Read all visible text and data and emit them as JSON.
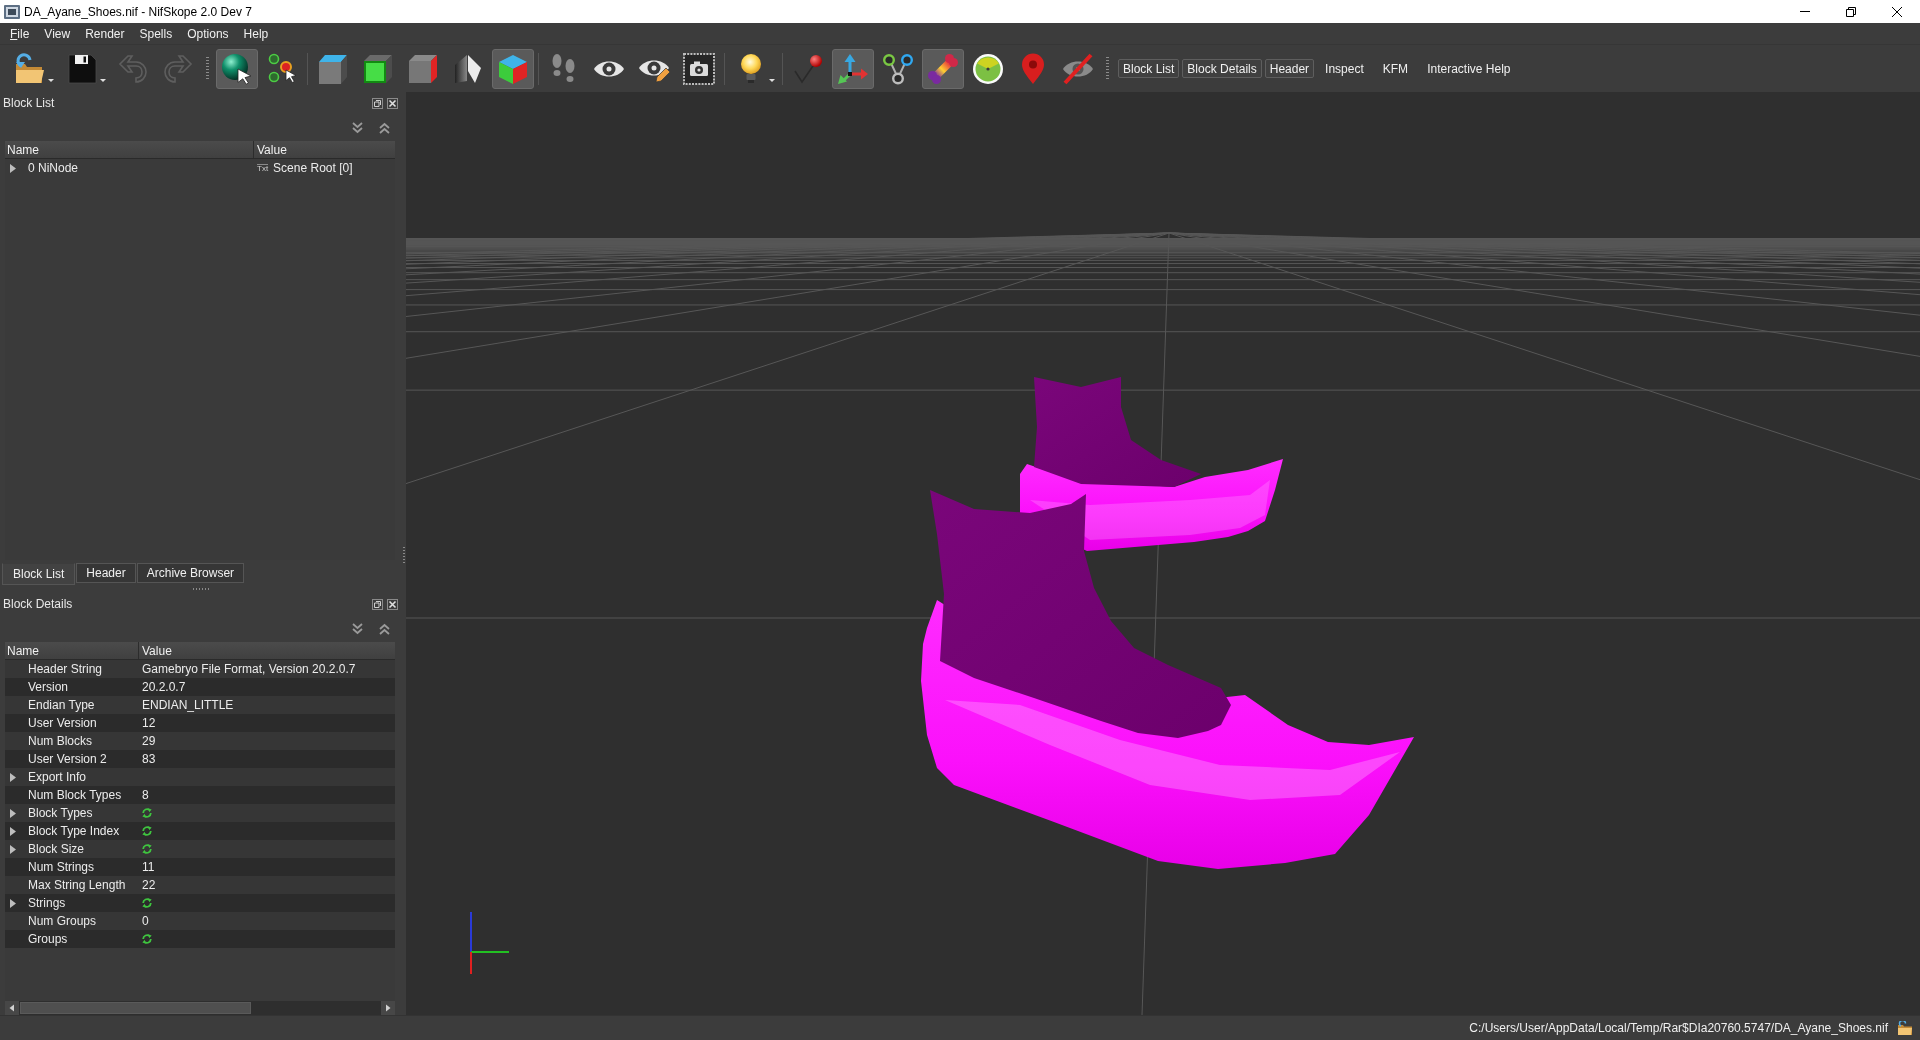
{
  "window": {
    "title": "DA_Ayane_Shoes.nif - NifSkope 2.0 Dev 7"
  },
  "menu": [
    {
      "label": "File",
      "mnemonic": true
    },
    {
      "label": "View",
      "mnemonic": false
    },
    {
      "label": "Render",
      "mnemonic": false
    },
    {
      "label": "Spells",
      "mnemonic": false
    },
    {
      "label": "Options",
      "mnemonic": false
    },
    {
      "label": "Help",
      "mnemonic": false
    }
  ],
  "toolbar": {
    "groups": [
      [
        {
          "pressed": false,
          "dropdown": true,
          "disabled": false
        },
        {
          "pressed": false,
          "dropdown": true,
          "disabled": false
        },
        {
          "pressed": false,
          "dropdown": false,
          "disabled": true
        },
        {
          "pressed": false,
          "dropdown": false,
          "disabled": true
        }
      ],
      [
        {
          "pressed": true,
          "dropdown": false,
          "disabled": false
        },
        {
          "pressed": false,
          "dropdown": false,
          "disabled": false
        }
      ],
      [
        {
          "pressed": false,
          "dropdown": false,
          "disabled": false
        },
        {
          "pressed": false,
          "dropdown": false,
          "disabled": false
        },
        {
          "pressed": false,
          "dropdown": false,
          "disabled": false
        },
        {
          "pressed": false,
          "dropdown": false,
          "disabled": false
        },
        {
          "pressed": true,
          "dropdown": false,
          "disabled": false
        }
      ],
      [
        {
          "pressed": false,
          "dropdown": false,
          "disabled": false
        },
        {
          "pressed": false,
          "dropdown": false,
          "disabled": false
        },
        {
          "pressed": false,
          "dropdown": false,
          "disabled": false
        },
        {
          "pressed": false,
          "dropdown": false,
          "disabled": false
        }
      ],
      [
        {
          "pressed": false,
          "dropdown": true,
          "disabled": false
        }
      ],
      [
        {
          "pressed": false,
          "dropdown": false,
          "disabled": false
        },
        {
          "pressed": true,
          "dropdown": false,
          "disabled": false
        },
        {
          "pressed": false,
          "dropdown": false,
          "disabled": false
        },
        {
          "pressed": true,
          "dropdown": false,
          "disabled": false
        },
        {
          "pressed": false,
          "dropdown": false,
          "disabled": false
        },
        {
          "pressed": false,
          "dropdown": false,
          "disabled": false
        },
        {
          "pressed": false,
          "dropdown": false,
          "disabled": false
        }
      ]
    ],
    "dock_buttons": [
      {
        "label": "Block List",
        "checked": true
      },
      {
        "label": "Block Details",
        "checked": true
      },
      {
        "label": "Header",
        "checked": true
      },
      {
        "label": "Inspect",
        "checked": false
      },
      {
        "label": "KFM",
        "checked": false
      },
      {
        "label": "Interactive Help",
        "checked": false
      }
    ]
  },
  "block_list": {
    "title": "Block List",
    "columns": [
      "Name",
      "Value"
    ],
    "rows": [
      {
        "name": "0 NiNode",
        "type_label": "Txt",
        "value": "Scene Root [0]",
        "expanded": false
      }
    ]
  },
  "dock_tabs": [
    {
      "label": "Block List",
      "selected": true
    },
    {
      "label": "Header",
      "selected": false
    },
    {
      "label": "Archive Browser",
      "selected": false
    }
  ],
  "block_details": {
    "title": "Block Details",
    "columns": [
      "Name",
      "Value"
    ],
    "rows": [
      {
        "name": "Header String",
        "kind": "value",
        "value": "Gamebryo File Format, Version 20.2.0.7"
      },
      {
        "name": "Version",
        "kind": "value",
        "value": "20.2.0.7"
      },
      {
        "name": "Endian Type",
        "kind": "value",
        "value": "ENDIAN_LITTLE"
      },
      {
        "name": "User Version",
        "kind": "value",
        "value": "12"
      },
      {
        "name": "Num Blocks",
        "kind": "value",
        "value": "29"
      },
      {
        "name": "User Version 2",
        "kind": "value",
        "value": "83"
      },
      {
        "name": "Export Info",
        "kind": "group",
        "expanded": false
      },
      {
        "name": "Num Block Types",
        "kind": "value",
        "value": "8"
      },
      {
        "name": "Block Types",
        "kind": "array",
        "expanded": false
      },
      {
        "name": "Block Type Index",
        "kind": "array",
        "expanded": false
      },
      {
        "name": "Block Size",
        "kind": "array",
        "expanded": false
      },
      {
        "name": "Num Strings",
        "kind": "value",
        "value": "11"
      },
      {
        "name": "Max String Length",
        "kind": "value",
        "value": "22"
      },
      {
        "name": "Strings",
        "kind": "array",
        "expanded": false
      },
      {
        "name": "Num Groups",
        "kind": "value",
        "value": "0"
      },
      {
        "name": "Groups",
        "kind": "array"
      }
    ]
  },
  "status_bar": {
    "path": "C:/Users/User/AppData/Local/Temp/Rar$DIa20760.5747/DA_Ayane_Shoes.nif"
  }
}
